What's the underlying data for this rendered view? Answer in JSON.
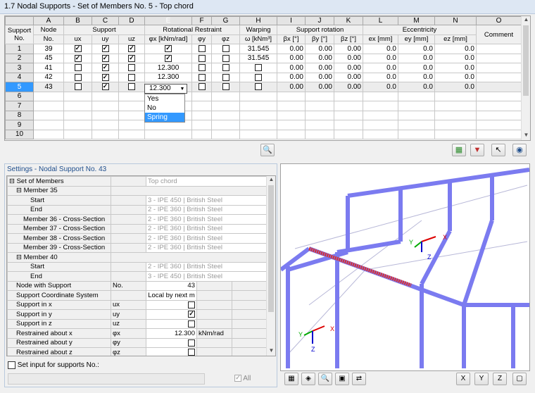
{
  "title": "1.7 Nodal Supports - Set of Members No. 5 - Top chord",
  "table": {
    "letters": [
      "A",
      "B",
      "C",
      "D",
      "E",
      "F",
      "G",
      "H",
      "I",
      "J",
      "K",
      "L",
      "M",
      "N",
      "O"
    ],
    "row_header_label": [
      "Support",
      "No."
    ],
    "group_headers": {
      "node": "Node",
      "support": "Support",
      "rot": "Rotational Restraint",
      "warp": "Warping",
      "suprot": "Support rotation",
      "ecc": "Eccentricity",
      "comment": "Comment"
    },
    "sub_headers": {
      "node": "No.",
      "ux": "ux",
      "uy": "uy",
      "uz": "uz",
      "phix": "φx [kNm/rad]",
      "phiy": "φy",
      "phiz": "φz",
      "omega": "ω [kNm³]",
      "bx": "βx [°]",
      "by": "βy [°]",
      "bz": "βz [°]",
      "ex": "ex [mm]",
      "ey": "ey [mm]",
      "ez": "ez [mm]"
    },
    "rows": [
      {
        "no": "1",
        "node": "39",
        "ux": true,
        "uy": true,
        "uz": true,
        "phix": "check",
        "phix_checked": true,
        "phiy": false,
        "phiz": false,
        "omega": "31.545",
        "bx": "0.00",
        "by": "0.00",
        "bz": "0.00",
        "ex": "0.0",
        "ey": "0.0",
        "ez": "0.0",
        "comment": ""
      },
      {
        "no": "2",
        "node": "45",
        "ux": true,
        "uy": true,
        "uz": true,
        "phix": "check",
        "phix_checked": true,
        "phiy": false,
        "phiz": false,
        "omega": "31.545",
        "bx": "0.00",
        "by": "0.00",
        "bz": "0.00",
        "ex": "0.0",
        "ey": "0.0",
        "ez": "0.0",
        "comment": ""
      },
      {
        "no": "3",
        "node": "41",
        "ux": false,
        "uy": true,
        "uz": false,
        "phix": "12.300",
        "phiy": false,
        "phiz": false,
        "omega": "check",
        "bx": "0.00",
        "by": "0.00",
        "bz": "0.00",
        "ex": "0.0",
        "ey": "0.0",
        "ez": "0.0",
        "comment": ""
      },
      {
        "no": "4",
        "node": "42",
        "ux": false,
        "uy": true,
        "uz": false,
        "phix": "12.300",
        "phiy": false,
        "phiz": false,
        "omega": "check",
        "bx": "0.00",
        "by": "0.00",
        "bz": "0.00",
        "ex": "0.0",
        "ey": "0.0",
        "ez": "0.0",
        "comment": ""
      },
      {
        "no": "5",
        "node": "43",
        "ux": false,
        "uy": true,
        "uz": false,
        "phix": "12.300",
        "phiy": false,
        "phiz": false,
        "omega": "check",
        "bx": "0.00",
        "by": "0.00",
        "bz": "0.00",
        "ex": "0.0",
        "ey": "0.0",
        "ez": "0.0",
        "comment": ""
      },
      {
        "no": "6"
      },
      {
        "no": "7"
      },
      {
        "no": "8"
      },
      {
        "no": "9"
      },
      {
        "no": "10"
      }
    ],
    "selected_row": 5,
    "edit_value": "12.300",
    "dropdown_options": [
      "Yes",
      "No",
      "Spring"
    ],
    "dropdown_highlighted": "Spring"
  },
  "settings": {
    "title": "Settings - Nodal Support No. 43",
    "rows": [
      {
        "label": "⊟ Set of Members",
        "sym": "",
        "val": "Top chord",
        "kind": "gray",
        "indent": 0
      },
      {
        "label": "⊟ Member 35",
        "sym": "",
        "val": "",
        "kind": "group",
        "indent": 1
      },
      {
        "label": "Start",
        "sym": "",
        "val": "3 - IPE 450 | British Steel",
        "kind": "gray",
        "indent": 3
      },
      {
        "label": "End",
        "sym": "",
        "val": "2 - IPE 360 | British Steel",
        "kind": "gray",
        "indent": 3
      },
      {
        "label": "Member 36 - Cross-Section",
        "sym": "",
        "val": "2 - IPE 360 | British Steel",
        "kind": "gray",
        "indent": 2
      },
      {
        "label": "Member 37 - Cross-Section",
        "sym": "",
        "val": "2 - IPE 360 | British Steel",
        "kind": "gray",
        "indent": 2
      },
      {
        "label": "Member 38 - Cross-Section",
        "sym": "",
        "val": "2 - IPE 360 | British Steel",
        "kind": "gray",
        "indent": 2
      },
      {
        "label": "Member 39 - Cross-Section",
        "sym": "",
        "val": "2 - IPE 360 | British Steel",
        "kind": "gray",
        "indent": 2
      },
      {
        "label": "⊟ Member 40",
        "sym": "",
        "val": "",
        "kind": "group",
        "indent": 1
      },
      {
        "label": "Start",
        "sym": "",
        "val": "2 - IPE 360 | British Steel",
        "kind": "gray",
        "indent": 3
      },
      {
        "label": "End",
        "sym": "",
        "val": "3 - IPE 450 | British Steel",
        "kind": "gray",
        "indent": 3
      },
      {
        "label": "Node with Support",
        "sym": "No.",
        "val": "43",
        "kind": "right",
        "indent": 1
      },
      {
        "label": "Support Coordinate System",
        "sym": "",
        "val": "Local by next m",
        "kind": "text",
        "indent": 1
      },
      {
        "label": "Support in x",
        "sym": "ux",
        "val": false,
        "kind": "check",
        "indent": 1
      },
      {
        "label": "Support in y",
        "sym": "uy",
        "val": true,
        "kind": "check",
        "indent": 1
      },
      {
        "label": "Support in z",
        "sym": "uz",
        "val": false,
        "kind": "check",
        "indent": 1
      },
      {
        "label": "Restrained about x",
        "sym": "φx",
        "val": "12.300",
        "unit": "kNm/rad",
        "kind": "edit",
        "indent": 1
      },
      {
        "label": "Restrained about y",
        "sym": "φy",
        "val": false,
        "kind": "check",
        "indent": 1
      },
      {
        "label": "Restrained about z",
        "sym": "φz",
        "val": false,
        "kind": "check",
        "indent": 1
      }
    ],
    "set_input_label": "Set input for supports No.:",
    "set_input_value": "",
    "all_label": "All"
  },
  "view3d": {
    "axis_labels": [
      "X",
      "Y",
      "Z"
    ],
    "member_color": "#7b7bf0",
    "highlight_color": "#d93030"
  },
  "toolbar_icons": [
    "view-icon",
    "import-icon",
    "export-icon",
    "pick-icon",
    "eye-icon"
  ],
  "view_toolbar_icons": [
    "member-select-icon",
    "display-icon",
    "zoom-icon",
    "color-icon",
    "renumber-icon",
    "view-x-icon",
    "view-y-icon",
    "view-z-icon",
    "iso-view-icon"
  ]
}
